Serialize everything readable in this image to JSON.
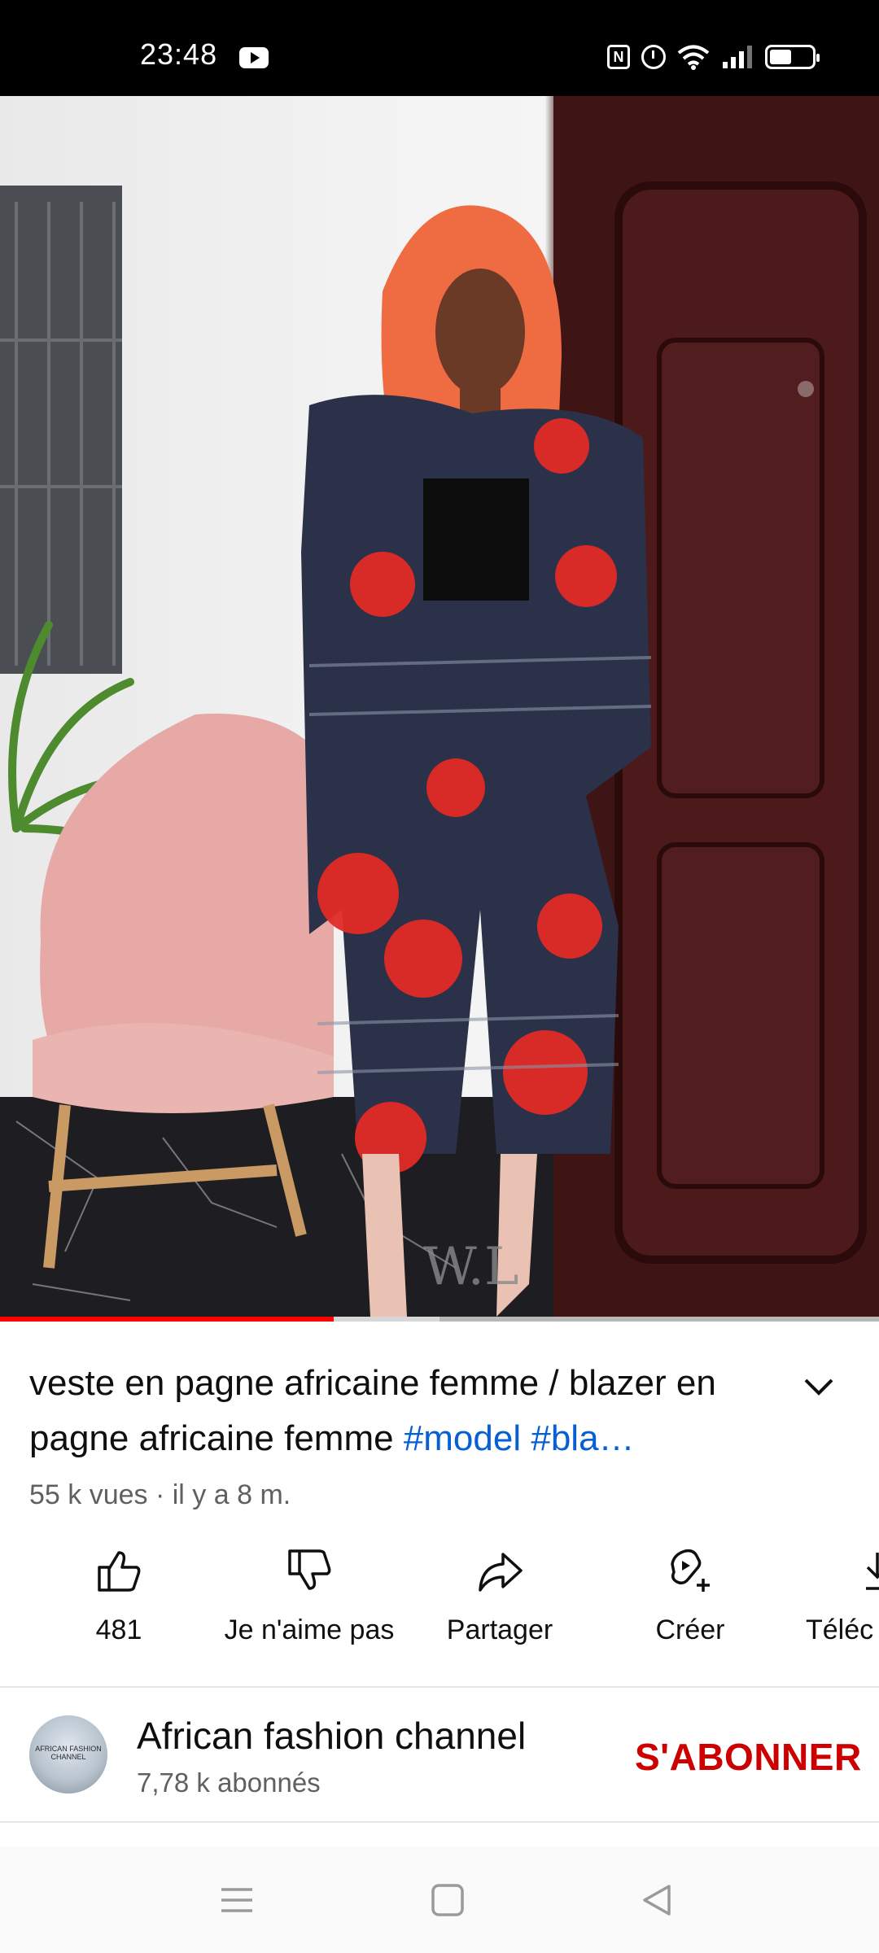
{
  "status_bar": {
    "time": "23:48",
    "icons": [
      "youtube-icon",
      "nfc-icon",
      "alarm-icon",
      "wifi-icon",
      "signal-icon",
      "battery-icon"
    ]
  },
  "video": {
    "progress_played": 0.38,
    "progress_buffered": 0.5,
    "watermark": "W.L"
  },
  "title": {
    "text": "veste en pagne africaine femme / blazer en pagne africaine femme ",
    "hashtags": "#model #bla…"
  },
  "meta": "55 k vues · il y a 8 m.",
  "actions": [
    {
      "label": "481",
      "icon": "thumbs-up-icon"
    },
    {
      "label": "Je n'aime pas",
      "icon": "thumbs-down-icon"
    },
    {
      "label": "Partager",
      "icon": "share-icon"
    },
    {
      "label": "Créer",
      "icon": "create-icon"
    },
    {
      "label": "Téléc",
      "icon": "download-icon"
    }
  ],
  "channel": {
    "name": "African fashion channel",
    "subscribers": "7,78 k abonnés",
    "avatar_text": "AFRICAN FASHION CHANNEL",
    "subscribe_label": "S'ABONNER"
  },
  "colors": {
    "accent_red": "#ff0000",
    "subscribe_red": "#cc0000",
    "hashtag_blue": "#065fd4",
    "secondary_text": "#606060"
  }
}
